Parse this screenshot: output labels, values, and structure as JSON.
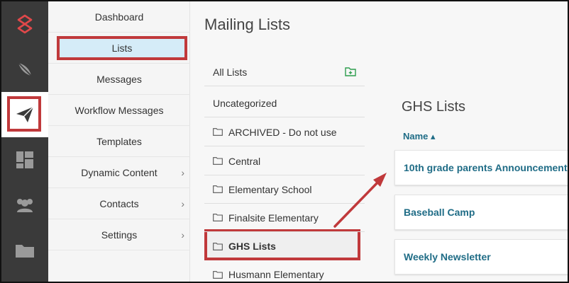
{
  "rail": {
    "items": [
      {
        "icon": "brand-logo-icon"
      },
      {
        "icon": "feather-icon"
      },
      {
        "icon": "paper-plane-icon",
        "active": true
      },
      {
        "icon": "dashboard-grid-icon"
      },
      {
        "icon": "people-icon"
      },
      {
        "icon": "folder-icon"
      }
    ],
    "accent": "#e0484a"
  },
  "submenu": {
    "items": [
      {
        "label": "Dashboard"
      },
      {
        "label": "Lists",
        "selected": true
      },
      {
        "label": "Messages"
      },
      {
        "label": "Workflow Messages"
      },
      {
        "label": "Templates"
      },
      {
        "label": "Dynamic Content",
        "has_children": true
      },
      {
        "label": "Contacts",
        "has_children": true
      },
      {
        "label": "Settings",
        "has_children": true
      }
    ],
    "chevron": "›"
  },
  "main": {
    "title": "Mailing Lists",
    "folders": [
      {
        "label": "All Lists"
      },
      {
        "label": "Uncategorized"
      },
      {
        "label": "ARCHIVED - Do not use"
      },
      {
        "label": "Central"
      },
      {
        "label": "Elementary School"
      },
      {
        "label": "Finalsite Elementary"
      },
      {
        "label": "GHS Lists",
        "selected": true
      },
      {
        "label": "Husmann Elementary"
      }
    ],
    "list": {
      "title": "GHS Lists",
      "column_header": "Name ▴",
      "rows": [
        {
          "name": "10th grade parents Announcement"
        },
        {
          "name": "Baseball Camp"
        },
        {
          "name": "Weekly Newsletter"
        }
      ]
    }
  },
  "colors": {
    "highlight": "#c0393b",
    "link": "#1f6c86",
    "rail_bg": "#3a3a3a",
    "selected_bg": "#d5ecf8",
    "add_icon": "#2e9e4f"
  }
}
